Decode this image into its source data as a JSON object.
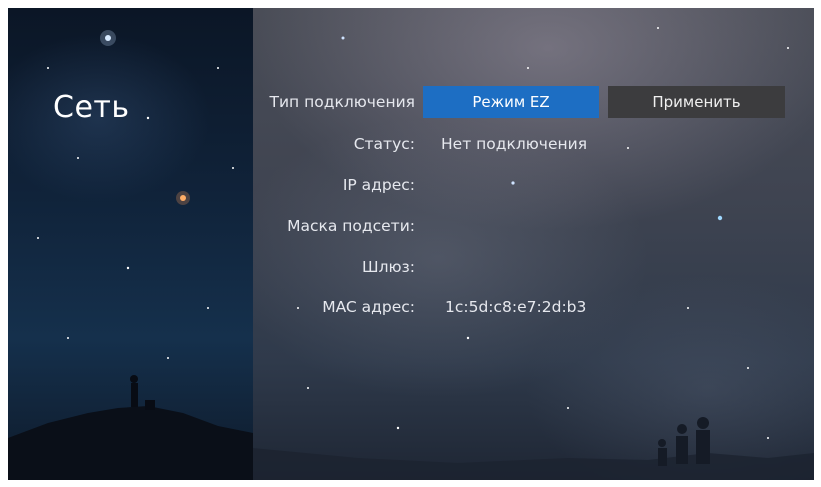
{
  "page": {
    "title": "Сеть"
  },
  "network": {
    "connection_type_label": "Тип подключения",
    "mode_button_label": "Режим EZ",
    "apply_button_label": "Применить",
    "status_label": "Статус:",
    "status_value": "Нет подключения",
    "ip_label": "IP адрес:",
    "ip_value": "",
    "mask_label": "Маска подсети:",
    "mask_value": "",
    "gateway_label": "Шлюз:",
    "gateway_value": "",
    "mac_label": "MAC адрес:",
    "mac_value": "1c:5d:c8:e7:2d:b3"
  },
  "colors": {
    "accent_button": "#1d6ec3",
    "secondary_button": "#3c3c3e",
    "text": "#e6e8ee"
  }
}
